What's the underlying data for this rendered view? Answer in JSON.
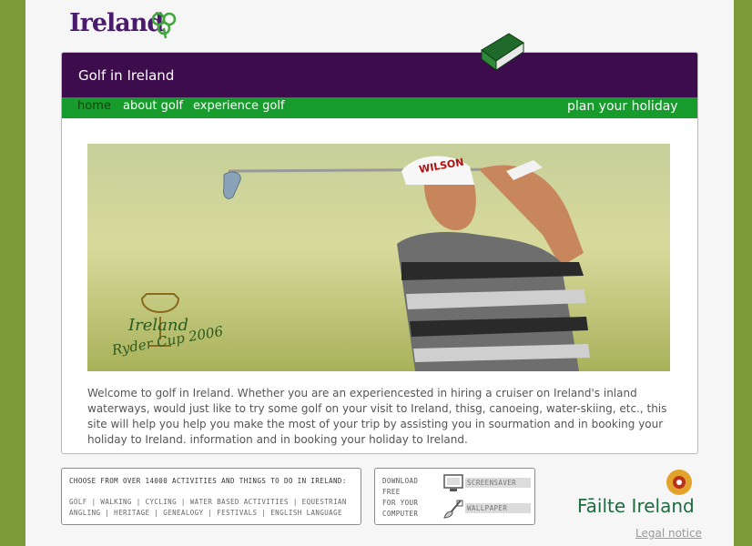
{
  "header": {
    "logo_text": "Ireland"
  },
  "panel": {
    "title": "Golf in Ireland"
  },
  "nav": {
    "items": [
      {
        "label": "home"
      },
      {
        "label": "about golf"
      },
      {
        "label": "experience golf"
      }
    ],
    "plan_label": "plan your holiday"
  },
  "hero": {
    "caption_line1": "Ireland",
    "caption_line2": "Ryder Cup 2006",
    "cap_text": "WILSON"
  },
  "intro": {
    "text": "Welcome to golf in Ireland. Whether you are an experiencested in hiring a cruiser on Ireland's inland waterways, would just like to try some golf on your visit to Ireland, thisg, canoeing, water-skiing, etc., this site will help you help you make the most of your trip by assisting you in sourmation and in booking your holiday to Ireland. information and in booking your holiday to Ireland."
  },
  "activities": {
    "heading": "Choose from over 14000 activities and things to do in Ireland:",
    "links": [
      "Golf",
      "Walking",
      "Cycling",
      "Water based activities",
      "Equestrian",
      "Angling",
      "Heritage",
      "Genealogy",
      "Festivals",
      "English language"
    ]
  },
  "download": {
    "text_lines": [
      "Download",
      "free",
      "for your",
      "computer"
    ],
    "screensaver_label": "Screensaver",
    "wallpaper_label": "Wallpaper"
  },
  "footer": {
    "brand": "Fāilte Ireland",
    "legal_label": "Legal notice"
  },
  "colors": {
    "background": "#7d9a3b",
    "title_bar": "#3c0c4c",
    "nav_bar": "#169b2c",
    "brand_green": "#1d6b3e",
    "logo_purple": "#4a1a6b"
  }
}
